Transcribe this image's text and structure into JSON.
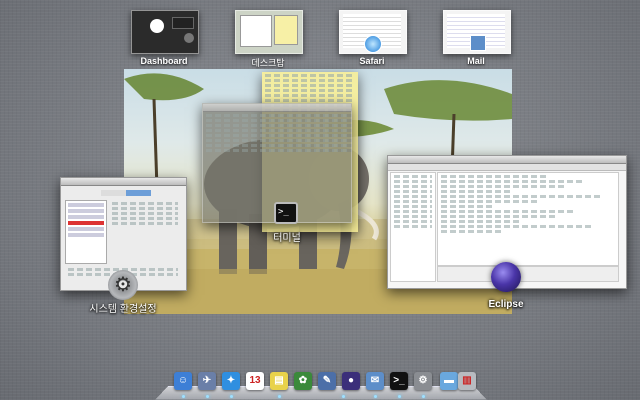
{
  "spaces": [
    {
      "label": "Dashboard"
    },
    {
      "label": "데스크탑"
    },
    {
      "label": "Safari"
    },
    {
      "label": "Mail"
    }
  ],
  "apps": {
    "terminal": "터미널",
    "system_prefs": "시스템 환경설정",
    "eclipse": "Eclipse"
  },
  "dock": [
    {
      "name": "finder-icon",
      "glyph": "☺",
      "color": "#3d7fd6"
    },
    {
      "name": "launchpad-icon",
      "glyph": "✈",
      "color": "#6a7fa8"
    },
    {
      "name": "safari-icon",
      "glyph": "✦",
      "color": "#2f8fe0"
    },
    {
      "name": "calendar-icon",
      "glyph": "13",
      "color": "#ffffff"
    },
    {
      "name": "stickies-icon",
      "glyph": "▤",
      "color": "#e8d24a"
    },
    {
      "name": "photo-icon",
      "glyph": "✿",
      "color": "#3b8a3b"
    },
    {
      "name": "xcode-icon",
      "glyph": "✎",
      "color": "#4c6fa8"
    },
    {
      "name": "eclipse-icon",
      "glyph": "●",
      "color": "#3b2f7a"
    },
    {
      "name": "mail-icon",
      "glyph": "✉",
      "color": "#5d8ec9"
    },
    {
      "name": "terminal-icon",
      "glyph": ">_",
      "color": "#111111"
    },
    {
      "name": "system-prefs-icon",
      "glyph": "⚙",
      "color": "#8a8d92"
    },
    {
      "name": "folder-icon",
      "glyph": "▬",
      "color": "#6aa8de"
    },
    {
      "name": "trash-icon",
      "glyph": "▥",
      "color": "#b8bbc0"
    }
  ]
}
